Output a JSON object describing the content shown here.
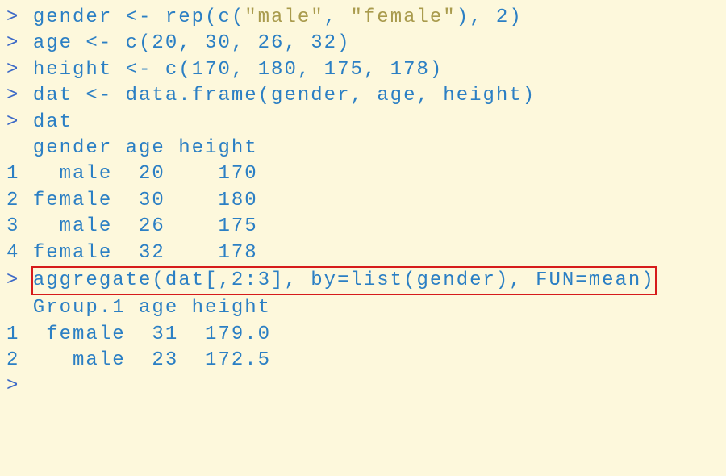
{
  "prompt": ">",
  "lines": {
    "l1_pre": "gender <- rep(c(",
    "l1_s1": "\"male\"",
    "l1_mid": ", ",
    "l1_s2": "\"female\"",
    "l1_post": "), 2)",
    "l2": "age <- c(20, 30, 26, 32)",
    "l3": "height <- c(170, 180, 175, 178)",
    "l4": "dat <- data.frame(gender, age, height)",
    "l5": "dat",
    "hdr1": "  gender age height",
    "r1": "1   male  20    170",
    "r2": "2 female  30    180",
    "r3": "3   male  26    175",
    "r4": "4 female  32    178",
    "l6": "aggregate(dat[,2:3], by=list(gender), FUN=mean)",
    "hdr2": "  Group.1 age height",
    "a1": "1  female  31  179.0",
    "a2": "2    male  23  172.5"
  }
}
